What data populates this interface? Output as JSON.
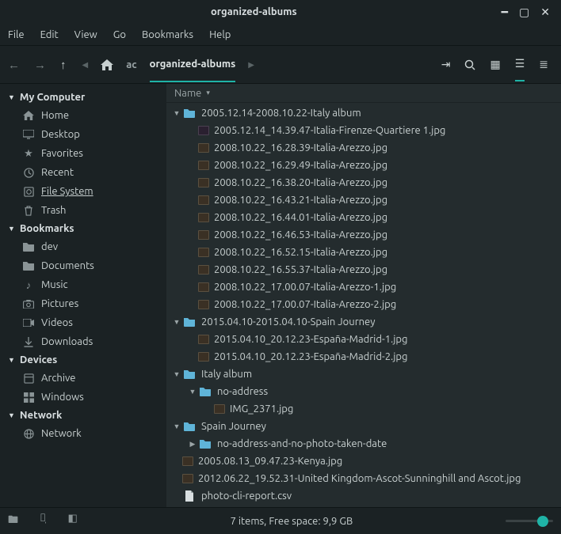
{
  "window": {
    "title": "organized-albums"
  },
  "menu": [
    "File",
    "Edit",
    "View",
    "Go",
    "Bookmarks",
    "Help"
  ],
  "breadcrumb": {
    "home_label": "ac",
    "current": "organized-albums"
  },
  "sidebar": {
    "sections": [
      {
        "label": "My Computer",
        "items": [
          {
            "icon": "home",
            "label": "Home"
          },
          {
            "icon": "desktop",
            "label": "Desktop"
          },
          {
            "icon": "star",
            "label": "Favorites"
          },
          {
            "icon": "clock",
            "label": "Recent"
          },
          {
            "icon": "disk",
            "label": "File System",
            "selected": true
          },
          {
            "icon": "trash",
            "label": "Trash"
          }
        ]
      },
      {
        "label": "Bookmarks",
        "items": [
          {
            "icon": "folder",
            "label": "dev"
          },
          {
            "icon": "folder",
            "label": "Documents"
          },
          {
            "icon": "music",
            "label": "Music"
          },
          {
            "icon": "camera",
            "label": "Pictures"
          },
          {
            "icon": "video",
            "label": "Videos"
          },
          {
            "icon": "download",
            "label": "Downloads"
          }
        ]
      },
      {
        "label": "Devices",
        "items": [
          {
            "icon": "archive",
            "label": "Archive"
          },
          {
            "icon": "windows",
            "label": "Windows"
          }
        ]
      },
      {
        "label": "Network",
        "items": [
          {
            "icon": "globe",
            "label": "Network"
          }
        ]
      }
    ]
  },
  "columns": {
    "name": "Name"
  },
  "tree": [
    {
      "depth": 0,
      "type": "folder",
      "expand": "open",
      "name": "2005.12.14-2008.10.22-Italy album"
    },
    {
      "depth": 1,
      "type": "img2",
      "name": "2005.12.14_14.39.47-Italia-Firenze-Quartiere 1.jpg"
    },
    {
      "depth": 1,
      "type": "img",
      "name": "2008.10.22_16.28.39-Italia-Arezzo.jpg"
    },
    {
      "depth": 1,
      "type": "img",
      "name": "2008.10.22_16.29.49-Italia-Arezzo.jpg"
    },
    {
      "depth": 1,
      "type": "img",
      "name": "2008.10.22_16.38.20-Italia-Arezzo.jpg"
    },
    {
      "depth": 1,
      "type": "img",
      "name": "2008.10.22_16.43.21-Italia-Arezzo.jpg"
    },
    {
      "depth": 1,
      "type": "img",
      "name": "2008.10.22_16.44.01-Italia-Arezzo.jpg"
    },
    {
      "depth": 1,
      "type": "img",
      "name": "2008.10.22_16.46.53-Italia-Arezzo.jpg"
    },
    {
      "depth": 1,
      "type": "img",
      "name": "2008.10.22_16.52.15-Italia-Arezzo.jpg"
    },
    {
      "depth": 1,
      "type": "img",
      "name": "2008.10.22_16.55.37-Italia-Arezzo.jpg"
    },
    {
      "depth": 1,
      "type": "img",
      "name": "2008.10.22_17.00.07-Italia-Arezzo-1.jpg"
    },
    {
      "depth": 1,
      "type": "img",
      "name": "2008.10.22_17.00.07-Italia-Arezzo-2.jpg"
    },
    {
      "depth": 0,
      "type": "folder",
      "expand": "open",
      "name": "2015.04.10-2015.04.10-Spain Journey"
    },
    {
      "depth": 1,
      "type": "img",
      "name": "2015.04.10_20.12.23-España-Madrid-1.jpg"
    },
    {
      "depth": 1,
      "type": "img",
      "name": "2015.04.10_20.12.23-España-Madrid-2.jpg"
    },
    {
      "depth": 0,
      "type": "folder",
      "expand": "open",
      "name": "Italy album"
    },
    {
      "depth": 1,
      "type": "folder",
      "expand": "open",
      "name": "no-address"
    },
    {
      "depth": 2,
      "type": "img",
      "name": "IMG_2371.jpg"
    },
    {
      "depth": 0,
      "type": "folder",
      "expand": "open",
      "name": "Spain Journey"
    },
    {
      "depth": 1,
      "type": "folder",
      "expand": "closed",
      "name": "no-address-and-no-photo-taken-date"
    },
    {
      "depth": 0,
      "type": "img",
      "name": "2005.08.13_09.47.23-Kenya.jpg"
    },
    {
      "depth": 0,
      "type": "img",
      "name": "2012.06.22_19.52.31-United Kingdom-Ascot-Sunninghill and Ascot.jpg"
    },
    {
      "depth": 0,
      "type": "file",
      "name": "photo-cli-report.csv"
    }
  ],
  "status": {
    "text": "7 items, Free space: 9,9 GB"
  }
}
